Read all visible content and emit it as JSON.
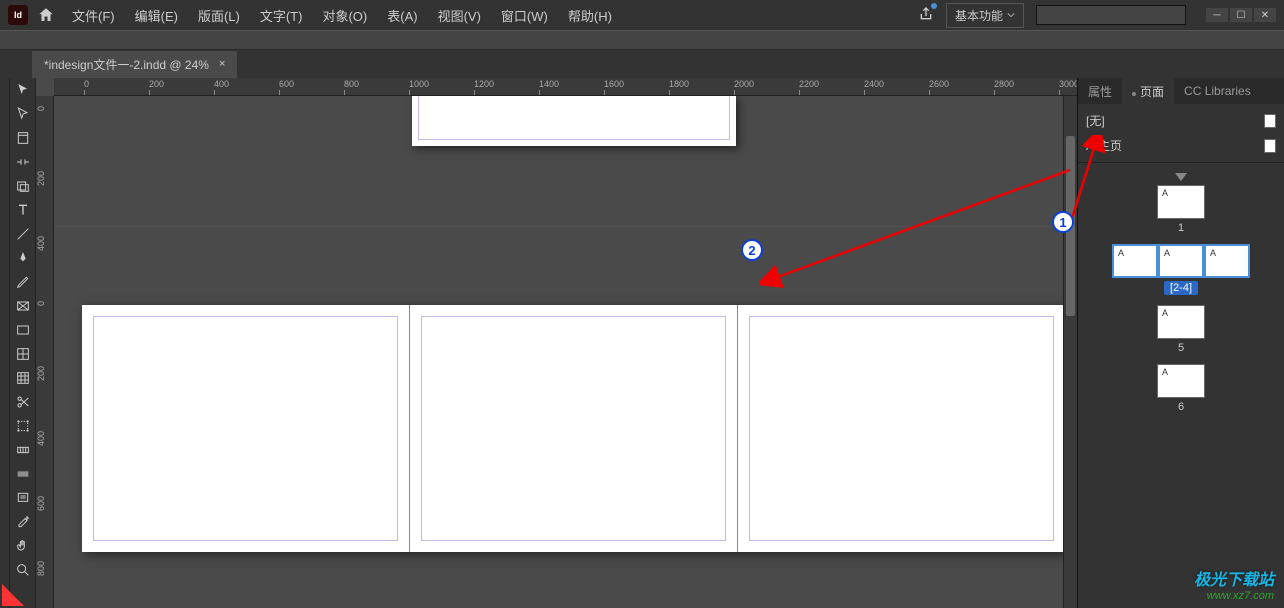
{
  "app": {
    "logo": "Id"
  },
  "menu": {
    "file": "文件(F)",
    "edit": "编辑(E)",
    "layout": "版面(L)",
    "type": "文字(T)",
    "object": "对象(O)",
    "table": "表(A)",
    "view": "视图(V)",
    "window": "窗口(W)",
    "help": "帮助(H)"
  },
  "workspace": {
    "label": "基本功能"
  },
  "tab": {
    "title": "*indesign文件一-2.indd @ 24%",
    "close": "×"
  },
  "ruler_h": [
    "0",
    "200",
    "400",
    "600",
    "800",
    "1000",
    "1200",
    "1400",
    "1600",
    "1800",
    "2000",
    "2200",
    "2400",
    "2600",
    "2800",
    "3000"
  ],
  "ruler_v": [
    "0",
    "200",
    "400",
    "0",
    "200",
    "400",
    "600",
    "800"
  ],
  "panel": {
    "tabs": {
      "properties": "属性",
      "pages": "页面",
      "cc": "CC Libraries"
    },
    "masters": {
      "none": "[无]",
      "a": "A-主页"
    },
    "pages": [
      {
        "labels": [
          "A"
        ],
        "num": "1"
      },
      {
        "labels": [
          "A",
          "A",
          "A"
        ],
        "num": "[2-4]",
        "selected": true
      },
      {
        "labels": [
          "A"
        ],
        "num": "5"
      },
      {
        "labels": [
          "A"
        ],
        "num": "6"
      }
    ]
  },
  "callouts": {
    "one": "1",
    "two": "2"
  },
  "watermark": {
    "top": "极光下载站",
    "bot": "www.xz7.com"
  }
}
